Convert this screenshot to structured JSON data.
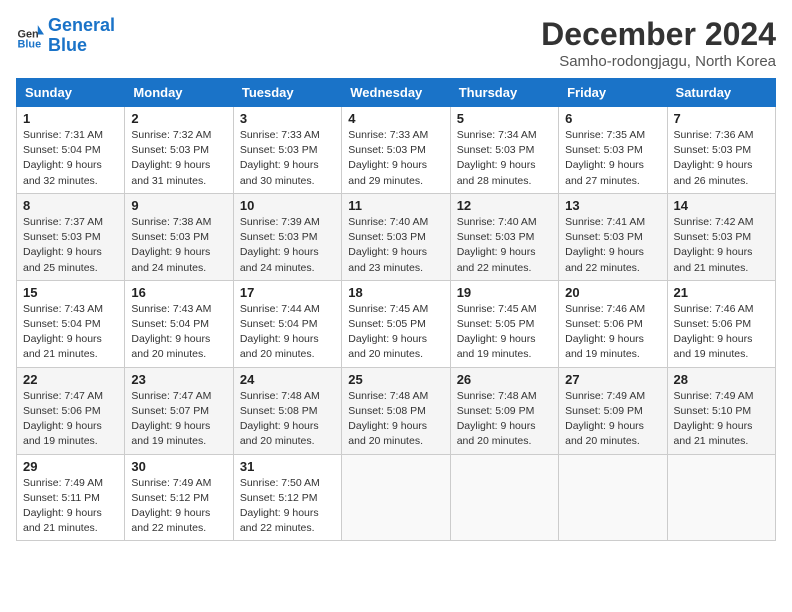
{
  "logo": {
    "line1": "General",
    "line2": "Blue"
  },
  "title": "December 2024",
  "location": "Samho-rodongjagu, North Korea",
  "weekdays": [
    "Sunday",
    "Monday",
    "Tuesday",
    "Wednesday",
    "Thursday",
    "Friday",
    "Saturday"
  ],
  "weeks": [
    [
      {
        "day": "1",
        "sunrise": "7:31 AM",
        "sunset": "5:04 PM",
        "daylight": "9 hours and 32 minutes."
      },
      {
        "day": "2",
        "sunrise": "7:32 AM",
        "sunset": "5:03 PM",
        "daylight": "9 hours and 31 minutes."
      },
      {
        "day": "3",
        "sunrise": "7:33 AM",
        "sunset": "5:03 PM",
        "daylight": "9 hours and 30 minutes."
      },
      {
        "day": "4",
        "sunrise": "7:33 AM",
        "sunset": "5:03 PM",
        "daylight": "9 hours and 29 minutes."
      },
      {
        "day": "5",
        "sunrise": "7:34 AM",
        "sunset": "5:03 PM",
        "daylight": "9 hours and 28 minutes."
      },
      {
        "day": "6",
        "sunrise": "7:35 AM",
        "sunset": "5:03 PM",
        "daylight": "9 hours and 27 minutes."
      },
      {
        "day": "7",
        "sunrise": "7:36 AM",
        "sunset": "5:03 PM",
        "daylight": "9 hours and 26 minutes."
      }
    ],
    [
      {
        "day": "8",
        "sunrise": "7:37 AM",
        "sunset": "5:03 PM",
        "daylight": "9 hours and 25 minutes."
      },
      {
        "day": "9",
        "sunrise": "7:38 AM",
        "sunset": "5:03 PM",
        "daylight": "9 hours and 24 minutes."
      },
      {
        "day": "10",
        "sunrise": "7:39 AM",
        "sunset": "5:03 PM",
        "daylight": "9 hours and 24 minutes."
      },
      {
        "day": "11",
        "sunrise": "7:40 AM",
        "sunset": "5:03 PM",
        "daylight": "9 hours and 23 minutes."
      },
      {
        "day": "12",
        "sunrise": "7:40 AM",
        "sunset": "5:03 PM",
        "daylight": "9 hours and 22 minutes."
      },
      {
        "day": "13",
        "sunrise": "7:41 AM",
        "sunset": "5:03 PM",
        "daylight": "9 hours and 22 minutes."
      },
      {
        "day": "14",
        "sunrise": "7:42 AM",
        "sunset": "5:03 PM",
        "daylight": "9 hours and 21 minutes."
      }
    ],
    [
      {
        "day": "15",
        "sunrise": "7:43 AM",
        "sunset": "5:04 PM",
        "daylight": "9 hours and 21 minutes."
      },
      {
        "day": "16",
        "sunrise": "7:43 AM",
        "sunset": "5:04 PM",
        "daylight": "9 hours and 20 minutes."
      },
      {
        "day": "17",
        "sunrise": "7:44 AM",
        "sunset": "5:04 PM",
        "daylight": "9 hours and 20 minutes."
      },
      {
        "day": "18",
        "sunrise": "7:45 AM",
        "sunset": "5:05 PM",
        "daylight": "9 hours and 20 minutes."
      },
      {
        "day": "19",
        "sunrise": "7:45 AM",
        "sunset": "5:05 PM",
        "daylight": "9 hours and 19 minutes."
      },
      {
        "day": "20",
        "sunrise": "7:46 AM",
        "sunset": "5:06 PM",
        "daylight": "9 hours and 19 minutes."
      },
      {
        "day": "21",
        "sunrise": "7:46 AM",
        "sunset": "5:06 PM",
        "daylight": "9 hours and 19 minutes."
      }
    ],
    [
      {
        "day": "22",
        "sunrise": "7:47 AM",
        "sunset": "5:06 PM",
        "daylight": "9 hours and 19 minutes."
      },
      {
        "day": "23",
        "sunrise": "7:47 AM",
        "sunset": "5:07 PM",
        "daylight": "9 hours and 19 minutes."
      },
      {
        "day": "24",
        "sunrise": "7:48 AM",
        "sunset": "5:08 PM",
        "daylight": "9 hours and 20 minutes."
      },
      {
        "day": "25",
        "sunrise": "7:48 AM",
        "sunset": "5:08 PM",
        "daylight": "9 hours and 20 minutes."
      },
      {
        "day": "26",
        "sunrise": "7:48 AM",
        "sunset": "5:09 PM",
        "daylight": "9 hours and 20 minutes."
      },
      {
        "day": "27",
        "sunrise": "7:49 AM",
        "sunset": "5:09 PM",
        "daylight": "9 hours and 20 minutes."
      },
      {
        "day": "28",
        "sunrise": "7:49 AM",
        "sunset": "5:10 PM",
        "daylight": "9 hours and 21 minutes."
      }
    ],
    [
      {
        "day": "29",
        "sunrise": "7:49 AM",
        "sunset": "5:11 PM",
        "daylight": "9 hours and 21 minutes."
      },
      {
        "day": "30",
        "sunrise": "7:49 AM",
        "sunset": "5:12 PM",
        "daylight": "9 hours and 22 minutes."
      },
      {
        "day": "31",
        "sunrise": "7:50 AM",
        "sunset": "5:12 PM",
        "daylight": "9 hours and 22 minutes."
      },
      null,
      null,
      null,
      null
    ]
  ],
  "labels": {
    "sunrise": "Sunrise:",
    "sunset": "Sunset:",
    "daylight": "Daylight:"
  }
}
